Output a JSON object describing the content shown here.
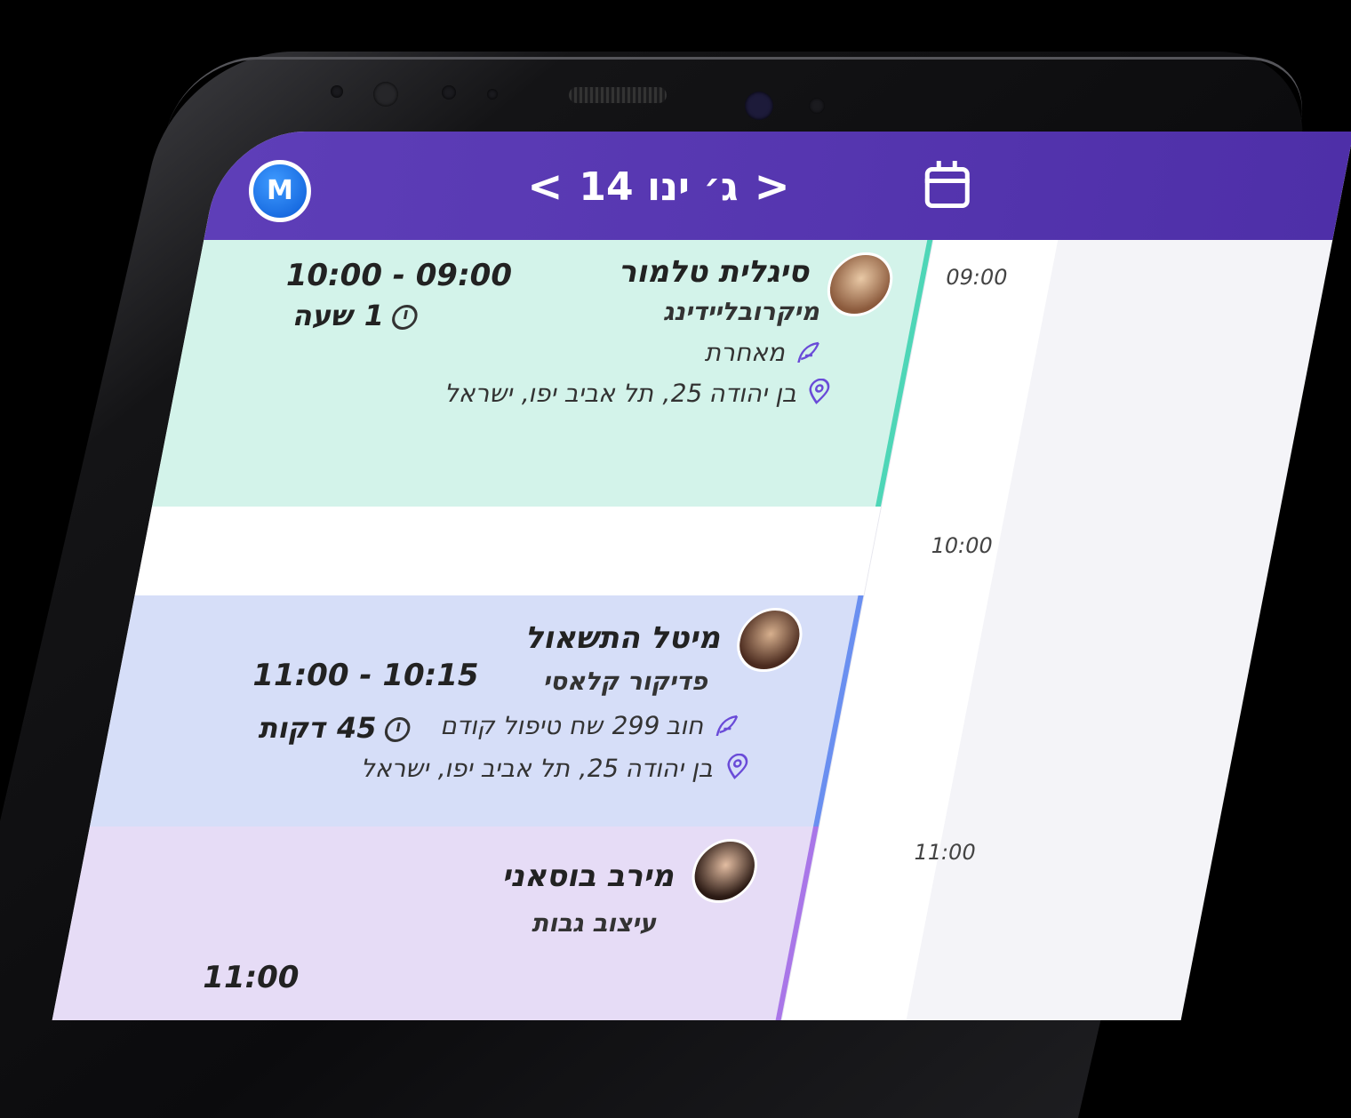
{
  "header": {
    "avatar_initial": "M",
    "date_label": "ג׳ ינו 14",
    "prev_icon": "chevron-left-icon",
    "next_icon": "chevron-right-icon",
    "calendar_icon": "calendar-icon"
  },
  "time_labels": [
    "09:00",
    "10:00",
    "11:00"
  ],
  "appointments": [
    {
      "client": "סיגלית טלמור",
      "service": "מיקרובליידינג",
      "note": "מאחרת",
      "address": "בן יהודה 25, תל אביב יפו, ישראל",
      "time_range": "10:00 - 09:00",
      "duration": "1 שעה",
      "color": "#d3f3ea",
      "bar_color": "#4ed6b7"
    },
    {
      "client": "מיטל התשאול",
      "service": "פדיקור קלאסי",
      "note": "חוב 299 שח טיפול קודם",
      "address": "בן יהודה 25, תל אביב יפו, ישראל",
      "time_range": "11:00 - 10:15",
      "duration": "45 דקות",
      "color": "#d6def8",
      "bar_color": "#6a8ff0"
    },
    {
      "client": "מירב בוסאני",
      "service": "עיצוב גבות",
      "time_range": "11:00",
      "color": "#e6dcf6",
      "bar_color": "#a976e8"
    }
  ]
}
